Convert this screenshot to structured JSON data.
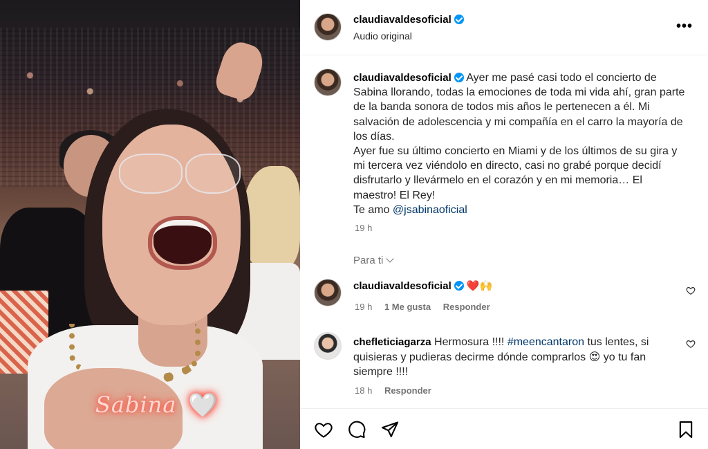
{
  "media": {
    "sticker_text": "Sabina",
    "sticker_heart": "🤍"
  },
  "header": {
    "username": "claudiavaldesoficial",
    "subtitle": "Audio original",
    "more_label": "•••"
  },
  "caption": {
    "username": "claudiavaldesoficial",
    "text": "Ayer me pasé casi todo el concierto de Sabina llorando, todas la emociones de toda mi vida ahí, gran parte de la banda sonora de todos mis años le pertenecen a él. Mi salvación de adolescencia y mi compañía en el carro la mayoría de los días.\nAyer fue su último concierto en Miami y de los últimos de su gira y mi tercera vez viéndolo en directo, casi no grabé porque decidí disfrutarlo y llevármelo en el corazón y en mi memoria… El maestro! El Rey!\nTe amo ",
    "mention": "@jsabinaoficial",
    "time": "19 h"
  },
  "para_ti": "Para ti",
  "comments": [
    {
      "username": "claudiavaldesoficial",
      "text": "❤️🙌",
      "time": "19 h",
      "likes": "1 Me gusta",
      "reply": "Responder"
    },
    {
      "username": "chefleticiagarza",
      "text_before": "Hermosura !!!! ",
      "hashtag": "#meencantaron",
      "text_after": " tus lentes, si quisieras y pudieras decirme dónde comprarlos 😍 yo tu fan siempre !!!!",
      "time": "18 h",
      "reply": "Responder"
    }
  ],
  "icons": {
    "like": "heart-icon",
    "comment": "comment-icon",
    "share": "share-icon",
    "save": "bookmark-icon",
    "verified": "verified-badge-icon"
  },
  "colors": {
    "verified": "#0095f6",
    "link": "#00376b",
    "secondary_text": "#737373"
  }
}
